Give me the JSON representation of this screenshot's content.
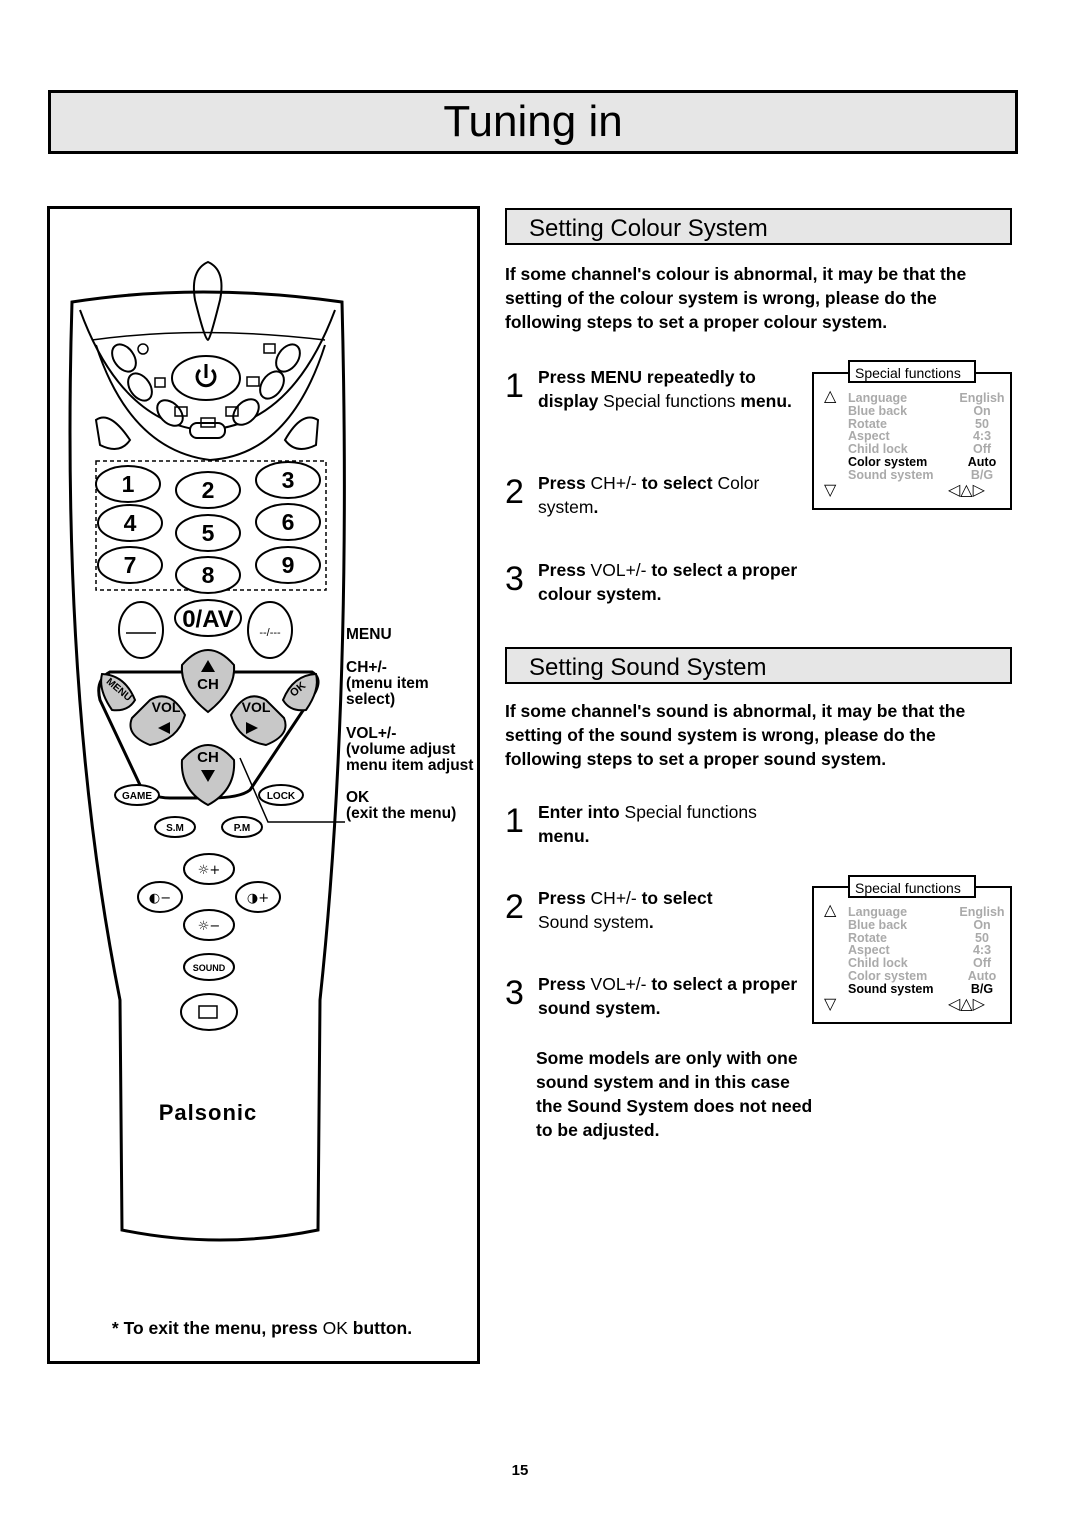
{
  "title": "Tuning in",
  "remote": {
    "keys": [
      "1",
      "2",
      "3",
      "4",
      "5",
      "6",
      "7",
      "8",
      "9"
    ],
    "zero_av": "0/AV",
    "dash_key": "--/---",
    "ch": "CH",
    "vol": "VOL",
    "menu": "MENU",
    "ok": "OK",
    "game": "GAME",
    "lock": "LOCK",
    "sm": "S.M",
    "pm": "P.M",
    "sound": "SOUND",
    "brand": "Palsonic",
    "labels": {
      "menu": "MENU",
      "ch": "CH+/-",
      "ch_desc1": "(menu item",
      "ch_desc2": "select)",
      "vol": "VOL+/-",
      "vol_desc1": "(volume adjust",
      "vol_desc2": "menu item adjust",
      "ok": "OK",
      "ok_desc": "(exit the menu)"
    }
  },
  "footer_note": {
    "pre": "* To exit the menu, press ",
    "key": "OK",
    "post": " button."
  },
  "colour": {
    "heading": "Setting Colour System",
    "intro": "If some channel's colour is abnormal, it may be that the setting of the colour system is wrong, please do the following steps to set a proper colour system.",
    "steps": [
      {
        "n": "1",
        "a": "Press MENU repeatedly to display ",
        "b": "Special functions",
        "c": " menu."
      },
      {
        "n": "2",
        "a": "Press ",
        "b": "CH+/-",
        "c": " to select ",
        "d": "Color system",
        "e": "."
      },
      {
        "n": "3",
        "a": "Press ",
        "b": "VOL+/-",
        "c": " to select a proper colour system."
      }
    ],
    "menu": {
      "title": "Special functions",
      "rows": [
        {
          "label": "Language",
          "value": "English"
        },
        {
          "label": "Blue back",
          "value": "On"
        },
        {
          "label": "Rotate",
          "value": "50"
        },
        {
          "label": "Aspect",
          "value": "4:3"
        },
        {
          "label": "Child lock",
          "value": "Off"
        },
        {
          "label": "Color system",
          "value": "Auto",
          "selected": true
        },
        {
          "label": "Sound system",
          "value": "B/G"
        }
      ]
    }
  },
  "sound": {
    "heading": "Setting Sound System",
    "intro": "If some channel's sound is abnormal, it may be that the setting of the sound system is wrong, please do the following steps to set a proper sound system.",
    "steps": [
      {
        "n": "1",
        "a": "Enter into ",
        "b": "Special functions",
        "c": " menu."
      },
      {
        "n": "2",
        "a": "Press ",
        "b": "CH+/-",
        "c": " to select ",
        "d": "Sound system",
        "e": "."
      },
      {
        "n": "3",
        "a": "Press ",
        "b": "VOL+/-",
        "c": " to select a proper sound system."
      }
    ],
    "note": "Some models are only with one sound system and in this case the Sound System does not need to be adjusted.",
    "menu": {
      "title": "Special functions",
      "rows": [
        {
          "label": "Language",
          "value": "English"
        },
        {
          "label": "Blue back",
          "value": "On"
        },
        {
          "label": "Rotate",
          "value": "50"
        },
        {
          "label": "Aspect",
          "value": "4:3"
        },
        {
          "label": "Child lock",
          "value": "Off"
        },
        {
          "label": "Color system",
          "value": "Auto"
        },
        {
          "label": "Sound system",
          "value": "B/G",
          "selected": true
        }
      ]
    }
  },
  "page_number": "15"
}
